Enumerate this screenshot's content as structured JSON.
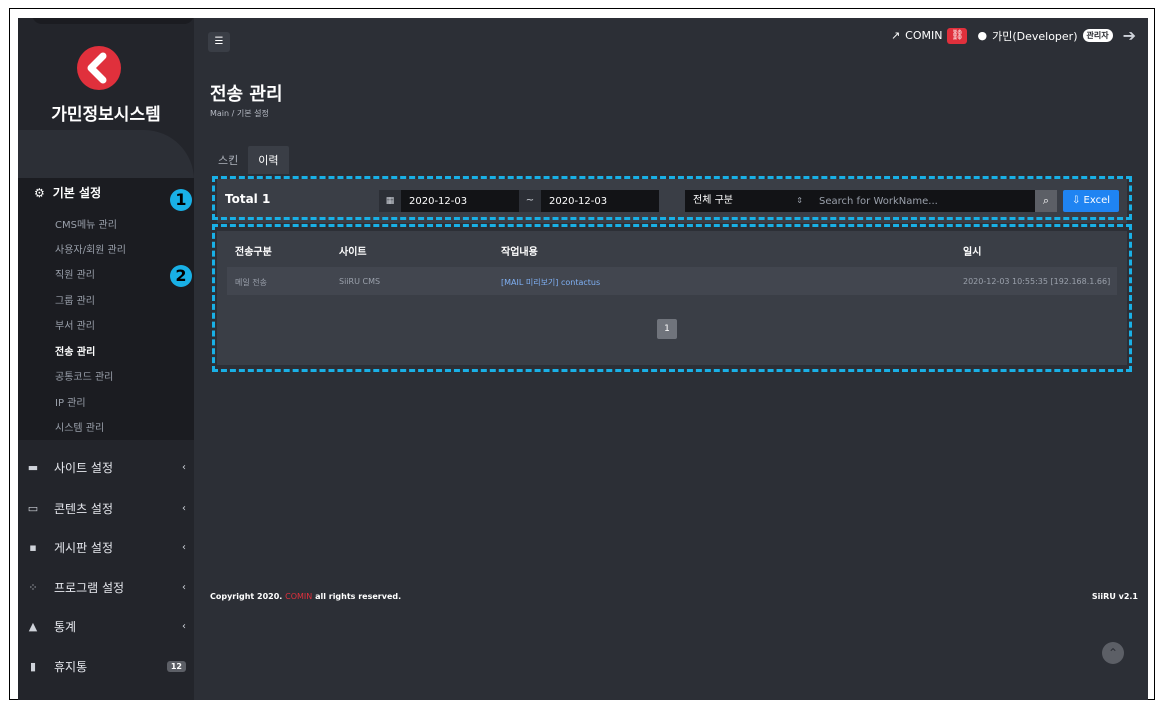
{
  "brand": {
    "name": "가민정보시스템",
    "logo_icon": "brand-logo-icon",
    "accent": "#e0303c"
  },
  "header": {
    "menu_toggle_icon": "hamburger-icon",
    "company_link": "COMIN",
    "user_name": "가민(Developer)",
    "user_role": "관리자",
    "logout_icon": "logout-icon"
  },
  "page": {
    "title": "전송 관리",
    "breadcrumb": "Main  /  기본 설정"
  },
  "tabs": [
    {
      "label": "스킨"
    },
    {
      "label": "이력",
      "active": true
    }
  ],
  "sidebar": {
    "group": {
      "label": "기본 설정",
      "icon": "gears-icon"
    },
    "sub_items": [
      {
        "label": "CMS메뉴 관리"
      },
      {
        "label": "사용자/회원 관리"
      },
      {
        "label": "직원 관리"
      },
      {
        "label": "그룹 관리"
      },
      {
        "label": "부서 관리"
      },
      {
        "label": "전송 관리",
        "active": true
      },
      {
        "label": "공통코드 관리"
      },
      {
        "label": "IP 관리"
      },
      {
        "label": "시스템 관리"
      }
    ],
    "items": [
      {
        "label": "사이트 설정",
        "icon": "site-icon"
      },
      {
        "label": "콘텐츠 설정",
        "icon": "content-icon"
      },
      {
        "label": "게시판 설정",
        "icon": "board-icon"
      },
      {
        "label": "프로그램 설정",
        "icon": "program-icon"
      },
      {
        "label": "통계",
        "icon": "chart-icon"
      },
      {
        "label": "휴지통",
        "icon": "trash-icon",
        "badge": "12"
      }
    ]
  },
  "toolbar": {
    "total_label": "Total 1",
    "date_from": "2020-12-03",
    "date_to": "2020-12-03",
    "date_separator": "~",
    "category_select": "전체 구분",
    "search_placeholder": "Search for WorkName...",
    "excel_label": "Excel"
  },
  "table": {
    "headers": [
      "전송구분",
      "사이트",
      "작업내용",
      "일시"
    ],
    "rows": [
      [
        "메일 전송",
        "SiiRU CMS",
        "[MAIL 미리보기] contactus",
        "2020-12-03 10:55:35 [192.168.1.66]"
      ]
    ]
  },
  "pagination": {
    "current": "1"
  },
  "annotations": {
    "first": "1",
    "second": "2",
    "color": "#19b0e6"
  },
  "footer": {
    "copyright_prefix": "Copyright 2020.",
    "copyright_brand": "COMIN",
    "copyright_suffix": "all rights reserved.",
    "version": "SiiRU v2.1"
  }
}
